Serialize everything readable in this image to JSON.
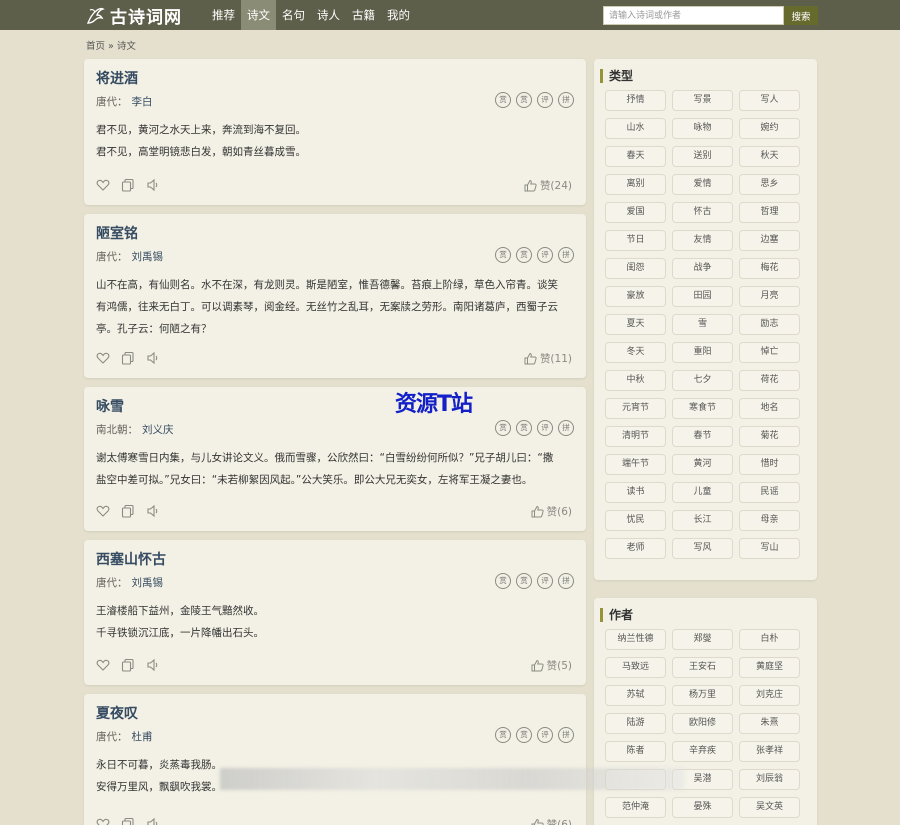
{
  "header": {
    "logo_text": "古诗词网",
    "nav": [
      "推荐",
      "诗文",
      "名句",
      "诗人",
      "古籍",
      "我的"
    ],
    "active_nav": 1,
    "search_placeholder": "请输入诗词或作者",
    "search_button": "搜索"
  },
  "breadcrumb": {
    "home": "首页",
    "sep": "»",
    "current": "诗文"
  },
  "poem_buttons": [
    "赏",
    "赏",
    "评",
    "拼"
  ],
  "poems": [
    {
      "title": "将进酒",
      "dynasty": "唐代：",
      "author": "李白",
      "lines": [
        "君不见，黄河之水天上来，奔流到海不复回。",
        "君不见，高堂明镜悲白发，朝如青丝暮成雪。"
      ],
      "likes": "赞(24)"
    },
    {
      "title": "陋室铭",
      "dynasty": "唐代：",
      "author": "刘禹锡",
      "lines": [
        "山不在高，有仙则名。水不在深，有龙则灵。斯是陋室，惟吾德馨。苔痕上阶绿，草色入帘青。谈笑",
        "有鸿儒，往来无白丁。可以调素琴，阅金经。无丝竹之乱耳，无案牍之劳形。南阳诸葛庐，西蜀子云",
        "亭。孔子云：何陋之有？"
      ],
      "likes": "赞(11)"
    },
    {
      "title": "咏雪",
      "dynasty": "南北朝：",
      "author": "刘义庆",
      "lines": [
        "谢太傅寒雪日内集，与儿女讲论文义。俄而雪骤，公欣然曰：“白雪纷纷何所似？”兄子胡儿曰：“撒",
        "盐空中差可拟。”兄女曰：“未若柳絮因风起。”公大笑乐。即公大兄无奕女，左将军王凝之妻也。"
      ],
      "likes": "赞(6)"
    },
    {
      "title": "西塞山怀古",
      "dynasty": "唐代：",
      "author": "刘禹锡",
      "lines": [
        "王濬楼船下益州，金陵王气黯然收。",
        "千寻铁锁沉江底，一片降幡出石头。"
      ],
      "likes": "赞(5)"
    },
    {
      "title": "夏夜叹",
      "dynasty": "唐代：",
      "author": "杜甫",
      "lines": [
        "永日不可暮，炎蒸毒我肠。",
        "安得万里风，飘飖吹我裳。"
      ],
      "likes": "赞(6)"
    }
  ],
  "sidebar": {
    "types_title": "类型",
    "types": [
      "抒情",
      "写景",
      "写人",
      "山水",
      "咏物",
      "婉约",
      "春天",
      "送别",
      "秋天",
      "离别",
      "爱情",
      "思乡",
      "爱国",
      "怀古",
      "哲理",
      "节日",
      "友情",
      "边塞",
      "闺怨",
      "战争",
      "梅花",
      "豪放",
      "田园",
      "月亮",
      "夏天",
      "雪",
      "励志",
      "冬天",
      "重阳",
      "悼亡",
      "中秋",
      "七夕",
      "荷花",
      "元宵节",
      "寒食节",
      "地名",
      "清明节",
      "春节",
      "菊花",
      "端午节",
      "黄河",
      "惜时",
      "读书",
      "儿童",
      "民谣",
      "忧民",
      "长江",
      "母亲",
      "老师",
      "写风",
      "写山"
    ],
    "authors_title": "作者",
    "authors": [
      "纳兰性德",
      "郑燮",
      "白朴",
      "马致远",
      "王安石",
      "黄庭坚",
      "苏轼",
      "杨万里",
      "刘克庄",
      "陆游",
      "欧阳修",
      "朱熹",
      "陈者",
      "辛弃疾",
      "张孝祥",
      "",
      "吴潜",
      "刘辰翁",
      "范仲淹",
      "晏殊",
      "吴文英"
    ]
  },
  "watermark": "资源T站",
  "colors": {
    "topbar": "#5e5f4a",
    "title": "#354b62",
    "accent": "#969438",
    "background": "#e4e0cd"
  }
}
